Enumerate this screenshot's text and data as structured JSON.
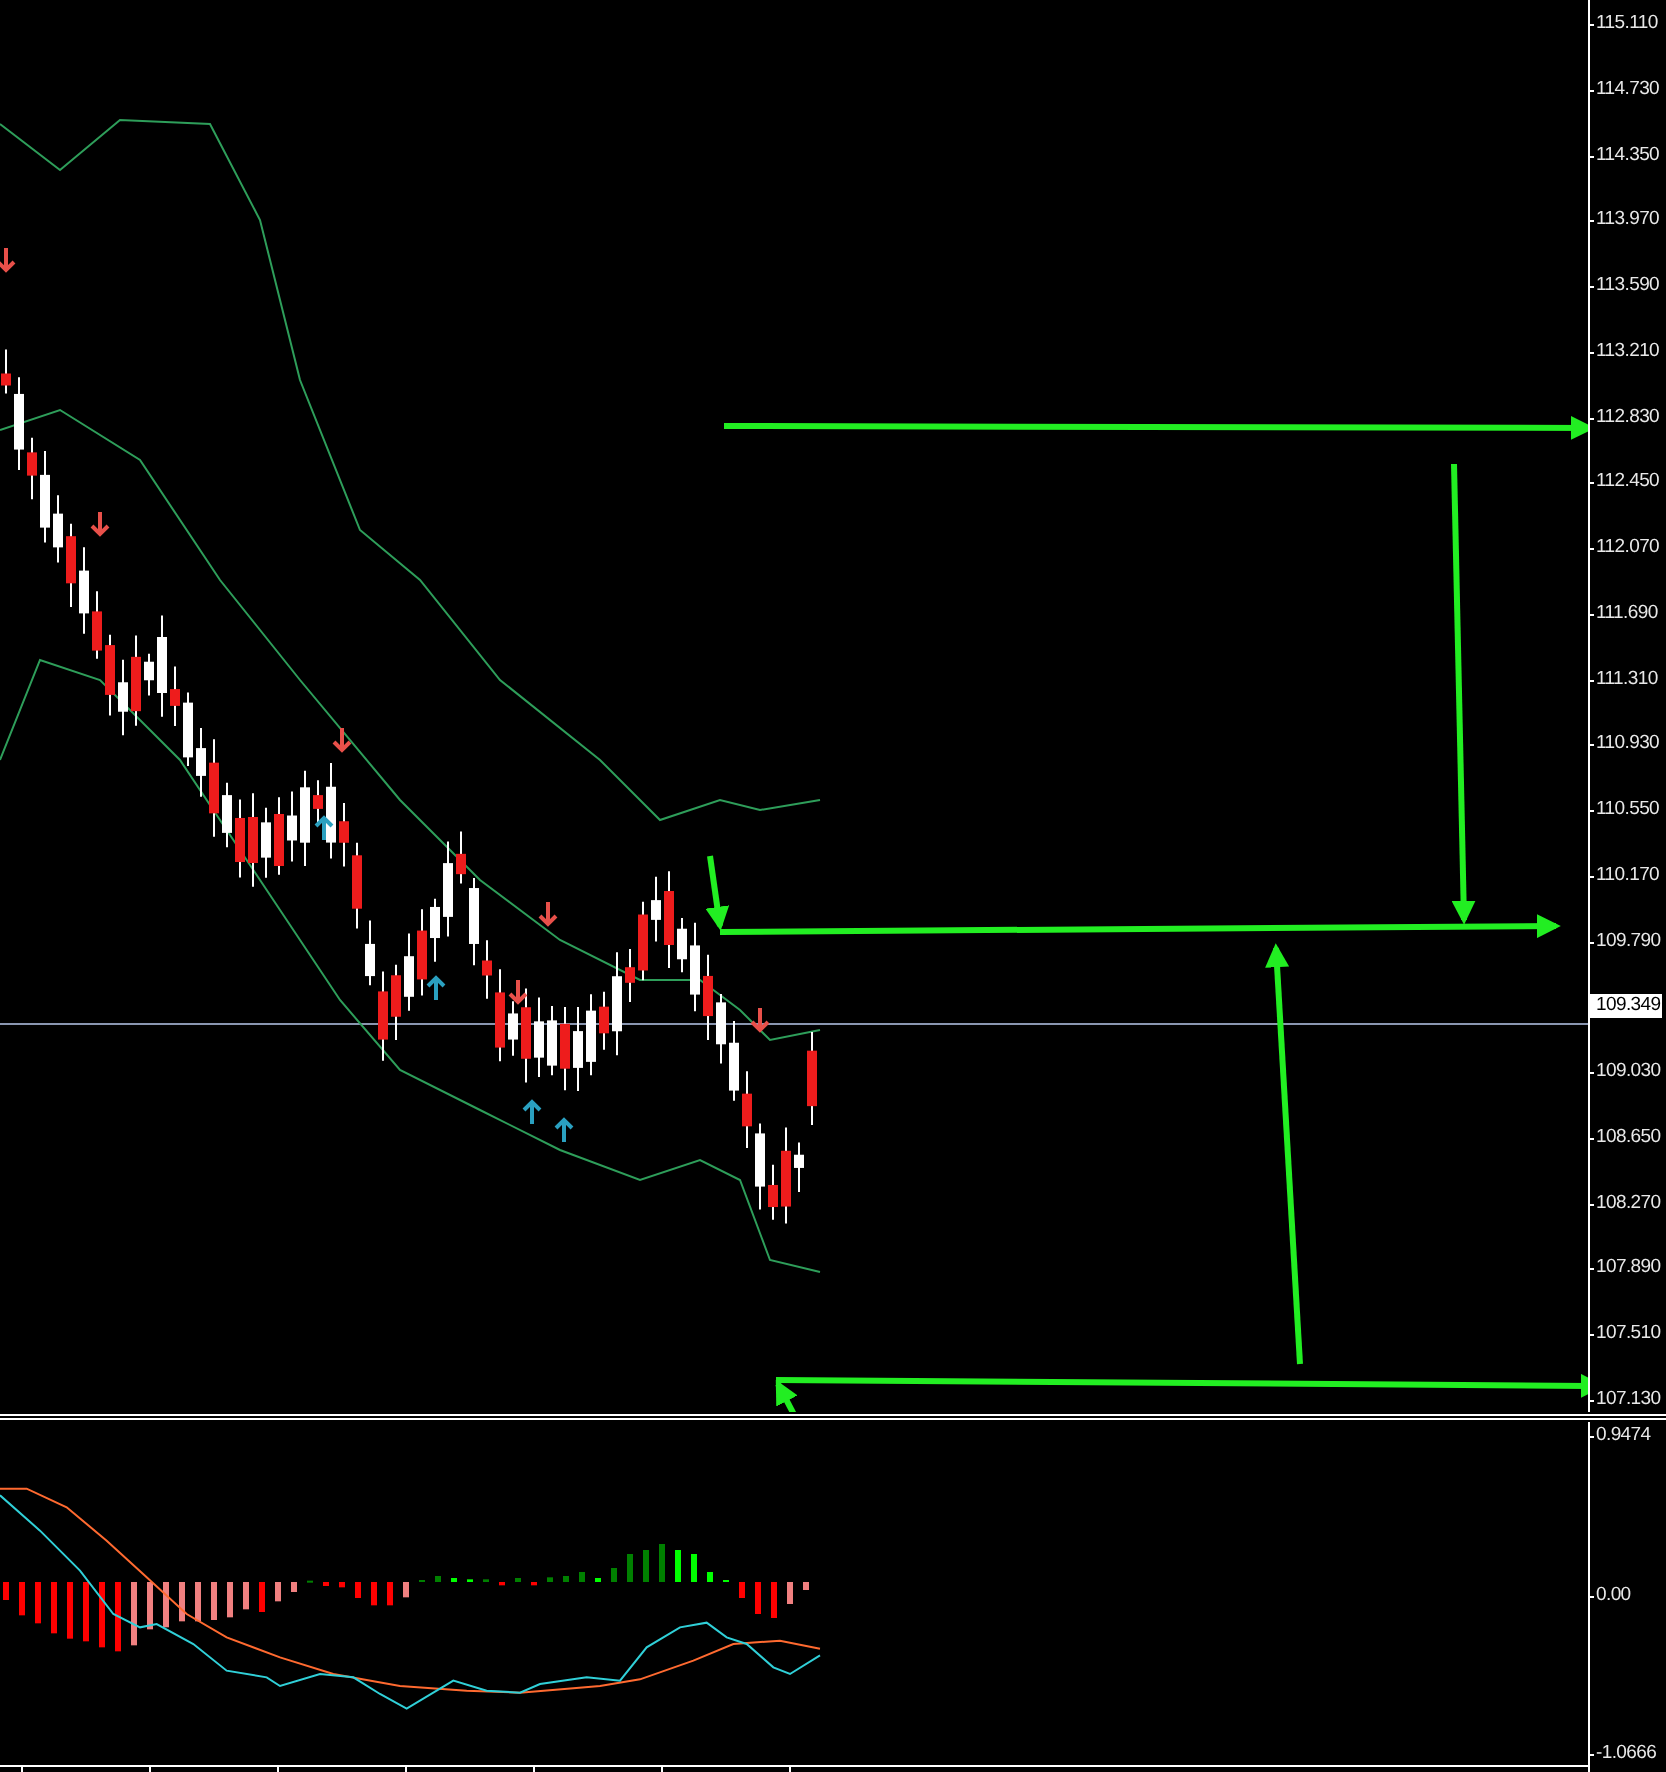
{
  "price_axis": {
    "items": [
      {
        "kind": "tick",
        "text": "115.110"
      },
      {
        "kind": "tick",
        "text": "114.730"
      },
      {
        "kind": "tick",
        "text": "114.350"
      },
      {
        "kind": "tick",
        "text": "113.970"
      },
      {
        "kind": "tick",
        "text": "113.590"
      },
      {
        "kind": "tick",
        "text": "113.210"
      },
      {
        "kind": "tick",
        "text": "112.830"
      },
      {
        "kind": "tick",
        "text": "112.450"
      },
      {
        "kind": "tick",
        "text": "112.070"
      },
      {
        "kind": "tick",
        "text": "111.690"
      },
      {
        "kind": "tick",
        "text": "111.310"
      },
      {
        "kind": "tick",
        "text": "110.930"
      },
      {
        "kind": "tick",
        "text": "110.550"
      },
      {
        "kind": "tick",
        "text": "110.170"
      },
      {
        "kind": "tick",
        "text": "109.790"
      },
      {
        "kind": "current",
        "text": "109.349"
      },
      {
        "kind": "tick",
        "text": "109.030"
      },
      {
        "kind": "tick",
        "text": "108.650"
      },
      {
        "kind": "tick",
        "text": "108.270"
      },
      {
        "kind": "tick",
        "text": "107.890"
      },
      {
        "kind": "tick",
        "text": "107.510"
      },
      {
        "kind": "tick",
        "text": "107.130"
      }
    ]
  },
  "indicator_axis": {
    "labels": [
      "0.9474",
      "0.00",
      "-1.0666"
    ]
  }
}
